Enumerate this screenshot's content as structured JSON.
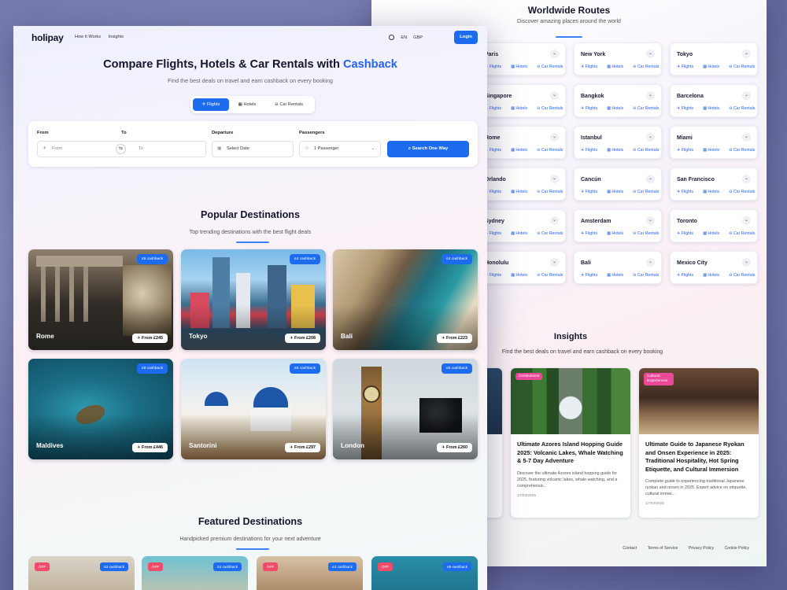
{
  "routes": {
    "title": "Worldwide Routes",
    "subtitle": "Discover amazing places around the world",
    "link_labels": [
      "Flights",
      "Hotels",
      "Car Rentals"
    ],
    "cities": [
      "Paris",
      "New York",
      "Tokyo",
      "Singapore",
      "Bangkok",
      "Barcelona",
      "Rome",
      "Istanbul",
      "Miami",
      "Orlando",
      "Cancún",
      "San Francisco",
      "Sydney",
      "Amsterdam",
      "Toronto",
      "Honolulu",
      "Bali",
      "Mexico City"
    ]
  },
  "insights": {
    "title": "Insights",
    "subtitle": "Find the best deals on travel and earn cashback on every booking",
    "articles": [
      {
        "tag": "Destinations",
        "title": "Ultimate Azores Island Hopping Guide 2025: Volcanic Lakes, Whale Watching & 5-7 Day Adventure",
        "excerpt": "Discover the ultimate Azores island hopping guide for 2025, featuring volcanic lakes, whale watching, and a comprehensiv...",
        "date": "17/03/2025"
      },
      {
        "tag": "Cultural Experiences",
        "title": "Ultimate Guide to Japanese Ryokan and Onsen Experience in 2025: Traditional Hospitality, Hot Spring Etiquette, and Cultural Immersion",
        "excerpt": "Complete guide to experiencing traditional Japanese ryokan and onsen in 2025. Expert advice on etiquette, cultural immer...",
        "date": "17/03/2025"
      }
    ]
  },
  "footer": {
    "links": [
      "Contact",
      "Terms of Service",
      "Privacy Policy",
      "Cookie Policy"
    ]
  },
  "nav": {
    "logo": "holipay",
    "links": [
      "How It Works",
      "Insights"
    ],
    "language": "EN",
    "currency": "GBP",
    "login": "Login"
  },
  "hero": {
    "title_main": "Compare Flights, Hotels & Car Rentals with",
    "title_accent": "Cashback",
    "subtitle": "Find the best deals on travel and earn cashback on every booking"
  },
  "tabs": [
    "Flights",
    "Hotels",
    "Car Rentals"
  ],
  "search": {
    "from_label": "From",
    "from_placeholder": "From",
    "to_label": "To",
    "to_placeholder": "To",
    "departure_label": "Departure",
    "departure_placeholder": "Select Date",
    "passengers_label": "Passengers",
    "passengers_value": "1 Passenger",
    "button": "Search One Way"
  },
  "popular": {
    "title": "Popular Destinations",
    "subtitle": "Top trending destinations with the best flight deals",
    "items": [
      {
        "name": "Rome",
        "cashback": "£5 cashback",
        "price": "From £245"
      },
      {
        "name": "Tokyo",
        "cashback": "£4 cashback",
        "price": "From £208"
      },
      {
        "name": "Bali",
        "cashback": "£4 cashback",
        "price": "From £223"
      },
      {
        "name": "Maldives",
        "cashback": "£9 cashback",
        "price": "From £446"
      },
      {
        "name": "Santorini",
        "cashback": "£6 cashback",
        "price": "From £297"
      },
      {
        "name": "London",
        "cashback": "£5 cashback",
        "price": "From £260"
      }
    ]
  },
  "featured": {
    "title": "Featured Destinations",
    "subtitle": "Handpicked premium destinations for your next adventure",
    "items": [
      {
        "badge": "OFF",
        "cashback": "£3 cashback"
      },
      {
        "badge": "OFF",
        "cashback": "£4 cashback"
      },
      {
        "badge": "OFF",
        "cashback": "£4 cashback"
      },
      {
        "badge": "OFF",
        "cashback": "£9 cashback"
      }
    ]
  }
}
